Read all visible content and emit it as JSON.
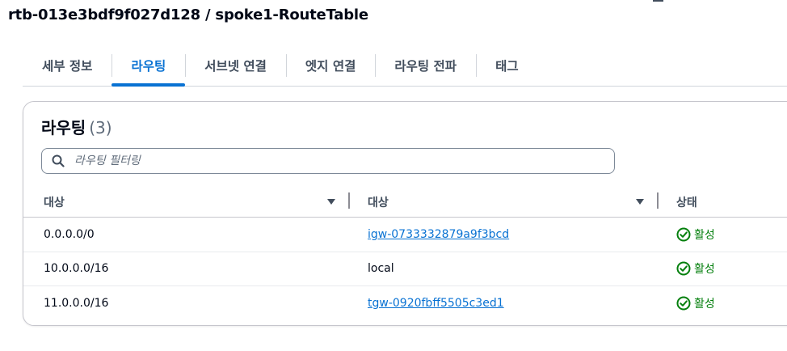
{
  "page": {
    "title": "rtb-013e3bdf9f027d128 / spoke1-RouteTable"
  },
  "tabs": [
    {
      "label": "세부 정보",
      "active": false
    },
    {
      "label": "라우팅",
      "active": true
    },
    {
      "label": "서브넷 연결",
      "active": false
    },
    {
      "label": "엣지 연결",
      "active": false
    },
    {
      "label": "라우팅 전파",
      "active": false
    },
    {
      "label": "태그",
      "active": false
    }
  ],
  "routes": {
    "title": "라우팅",
    "count": "(3)",
    "filter_placeholder": "라우팅 필터링",
    "columns": [
      "대상",
      "대상",
      "상태"
    ],
    "rows": [
      {
        "destination": "0.0.0.0/0",
        "target": "igw-0733332879a9f3bcd",
        "target_link": true,
        "status": "활성"
      },
      {
        "destination": "10.0.0.0/16",
        "target": "local",
        "target_link": false,
        "status": "활성"
      },
      {
        "destination": "11.0.0.0/16",
        "target": "tgw-0920fbff5505c3ed1",
        "target_link": true,
        "status": "활성"
      }
    ]
  },
  "colors": {
    "accent": "#0972d3",
    "success": "#037f0c",
    "text": "#000716"
  },
  "icons": {
    "search": "search-icon",
    "sort": "sort-down-icon",
    "status": "check-circle-icon"
  }
}
